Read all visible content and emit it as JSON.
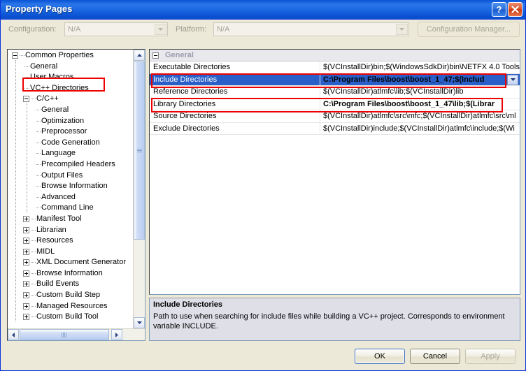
{
  "window": {
    "title": "Property Pages",
    "help_button": "?",
    "close_button": "×"
  },
  "configbar": {
    "configuration_label": "Configuration:",
    "configuration_value": "N/A",
    "platform_label": "Platform:",
    "platform_value": "N/A",
    "configuration_manager_button": "Configuration Manager..."
  },
  "tree": {
    "nodes": [
      {
        "label": "Common Properties",
        "depth": 0,
        "toggle": "minus"
      },
      {
        "label": "General",
        "depth": 1,
        "toggle": "none"
      },
      {
        "label": "User Macros",
        "depth": 1,
        "toggle": "none"
      },
      {
        "label": "VC++ Directories",
        "depth": 1,
        "toggle": "none",
        "selected": true
      },
      {
        "label": "C/C++",
        "depth": 1,
        "toggle": "minus"
      },
      {
        "label": "General",
        "depth": 2,
        "toggle": "none"
      },
      {
        "label": "Optimization",
        "depth": 2,
        "toggle": "none"
      },
      {
        "label": "Preprocessor",
        "depth": 2,
        "toggle": "none"
      },
      {
        "label": "Code Generation",
        "depth": 2,
        "toggle": "none"
      },
      {
        "label": "Language",
        "depth": 2,
        "toggle": "none"
      },
      {
        "label": "Precompiled Headers",
        "depth": 2,
        "toggle": "none"
      },
      {
        "label": "Output Files",
        "depth": 2,
        "toggle": "none"
      },
      {
        "label": "Browse Information",
        "depth": 2,
        "toggle": "none"
      },
      {
        "label": "Advanced",
        "depth": 2,
        "toggle": "none"
      },
      {
        "label": "Command Line",
        "depth": 2,
        "toggle": "none"
      },
      {
        "label": "Manifest Tool",
        "depth": 1,
        "toggle": "plus"
      },
      {
        "label": "Librarian",
        "depth": 1,
        "toggle": "plus"
      },
      {
        "label": "Resources",
        "depth": 1,
        "toggle": "plus"
      },
      {
        "label": "MIDL",
        "depth": 1,
        "toggle": "plus"
      },
      {
        "label": "XML Document Generator",
        "depth": 1,
        "toggle": "plus"
      },
      {
        "label": "Browse Information",
        "depth": 1,
        "toggle": "plus"
      },
      {
        "label": "Build Events",
        "depth": 1,
        "toggle": "plus"
      },
      {
        "label": "Custom Build Step",
        "depth": 1,
        "toggle": "plus"
      },
      {
        "label": "Managed Resources",
        "depth": 1,
        "toggle": "plus"
      },
      {
        "label": "Custom Build Tool",
        "depth": 1,
        "toggle": "plus"
      }
    ]
  },
  "grid": {
    "category": "General",
    "rows": [
      {
        "name": "Executable Directories",
        "value": "$(VCInstallDir)bin;$(WindowsSdkDir)bin\\NETFX 4.0 Tools",
        "bold": false,
        "selected": false,
        "dropdown": false
      },
      {
        "name": "Include Directories",
        "value": "C:\\Program Files\\boost\\boost_1_47;$(Includ",
        "bold": true,
        "selected": true,
        "dropdown": true
      },
      {
        "name": "Reference Directories",
        "value": "$(VCInstallDir)atlmfc\\lib;$(VCInstallDir)lib",
        "bold": false,
        "selected": false,
        "dropdown": false
      },
      {
        "name": "Library Directories",
        "value": "C:\\Program Files\\boost\\boost_1_47\\lib;$(Librar",
        "bold": true,
        "selected": false,
        "dropdown": false
      },
      {
        "name": "Source Directories",
        "value": "$(VCInstallDir)atlmfc\\src\\mfc;$(VCInstallDir)atlmfc\\src\\ml",
        "bold": false,
        "selected": false,
        "dropdown": false
      },
      {
        "name": "Exclude Directories",
        "value": "$(VCInstallDir)include;$(VCInstallDir)atlmfc\\include;$(Wi",
        "bold": false,
        "selected": false,
        "dropdown": false
      }
    ]
  },
  "description": {
    "title": "Include Directories",
    "text": "Path to use when searching for include files while building a VC++ project.  Corresponds to environment variable INCLUDE."
  },
  "footer": {
    "ok": "OK",
    "cancel": "Cancel",
    "apply": "Apply"
  },
  "annotation": {
    "color": "#ee0000"
  }
}
